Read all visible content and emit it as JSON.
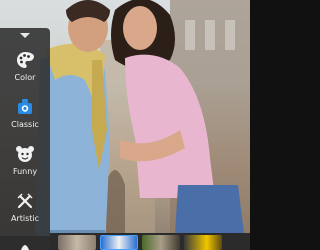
{
  "panel": {
    "categories": [
      {
        "label": "Color",
        "icon": "palette-icon"
      },
      {
        "label": "Classic",
        "icon": "classic-camera-icon"
      },
      {
        "label": "Funny",
        "icon": "funny-face-icon"
      },
      {
        "label": "Artistic",
        "icon": "brush-icon"
      }
    ]
  },
  "thumbnails": [
    "effect-1",
    "effect-2",
    "effect-3",
    "effect-4"
  ],
  "colors": {
    "panel_bg": "#2d2d2d",
    "label": "#f2f2f2",
    "selected": "#4aa0ff"
  }
}
